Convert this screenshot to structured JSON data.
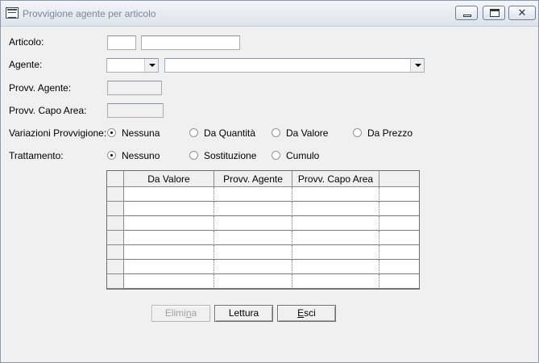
{
  "window": {
    "title": "Provvigione agente  per articolo",
    "min_icon": "window-minimize-icon",
    "max_icon": "window-restore-icon",
    "close_icon": "window-close-icon",
    "close_glyph": "✕"
  },
  "form": {
    "articolo_label": "Articolo:",
    "articolo_code": "",
    "articolo_desc": "",
    "agente_label": "Agente:",
    "agente_code": "",
    "agente_name": "",
    "provv_agente_label": "Provv. Agente:",
    "provv_agente_value": "",
    "provv_capo_label": "Provv. Capo Area:",
    "provv_capo_value": "",
    "variazioni_label": "Variazioni Provvigione:",
    "variazioni_options": [
      "Nessuna",
      "Da Quantità",
      "Da Valore",
      "Da Prezzo"
    ],
    "variazioni_selected": "Nessuna",
    "trattamento_label": "Trattamento:",
    "trattamento_options": [
      "Nessuno",
      "Sostituzione",
      "Cumulo"
    ],
    "trattamento_selected": "Nessuno"
  },
  "grid": {
    "columns": [
      "Da Valore",
      "Provv. Agente",
      "Provv. Capo Area",
      ""
    ],
    "rows": [
      [
        "",
        "",
        "",
        ""
      ],
      [
        "",
        "",
        "",
        ""
      ],
      [
        "",
        "",
        "",
        ""
      ],
      [
        "",
        "",
        "",
        ""
      ],
      [
        "",
        "",
        "",
        ""
      ],
      [
        "",
        "",
        "",
        ""
      ],
      [
        "",
        "",
        "",
        ""
      ]
    ]
  },
  "buttons": {
    "elimina": "Elimina",
    "lettura": "Lettura",
    "esci": "Esci"
  },
  "colors": {
    "window_bg": "#f0f0f0",
    "title_text": "#7a8896",
    "disabled_text": "#a0a0a0"
  }
}
